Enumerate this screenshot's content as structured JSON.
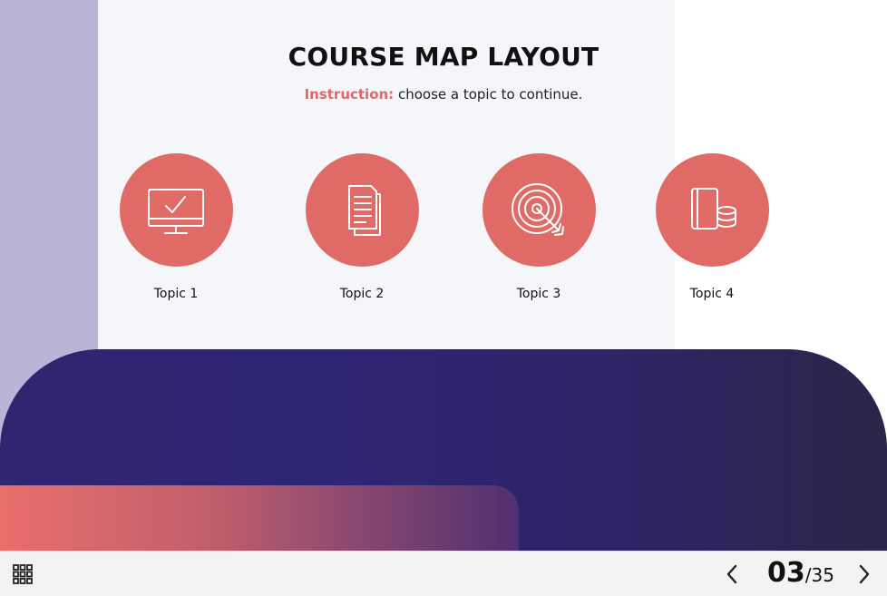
{
  "slide": {
    "title": "COURSE MAP LAYOUT",
    "instruction_label": "Instruction:",
    "instruction_text": " choose a topic to continue."
  },
  "topics": [
    {
      "label": "Topic 1",
      "icon": "monitor-check-icon"
    },
    {
      "label": "Topic 2",
      "icon": "documents-icon"
    },
    {
      "label": "Topic 3",
      "icon": "target-arrow-icon"
    },
    {
      "label": "Topic 4",
      "icon": "book-coins-icon"
    }
  ],
  "colors": {
    "accent": "#e06a66",
    "navy": "#2f2570",
    "lavender": "#b8b5d7"
  },
  "navigation": {
    "current_page": "03",
    "total_pages": "/35",
    "menu_icon": "grid-menu-icon",
    "prev_icon": "chevron-left-icon",
    "next_icon": "chevron-right-icon"
  }
}
